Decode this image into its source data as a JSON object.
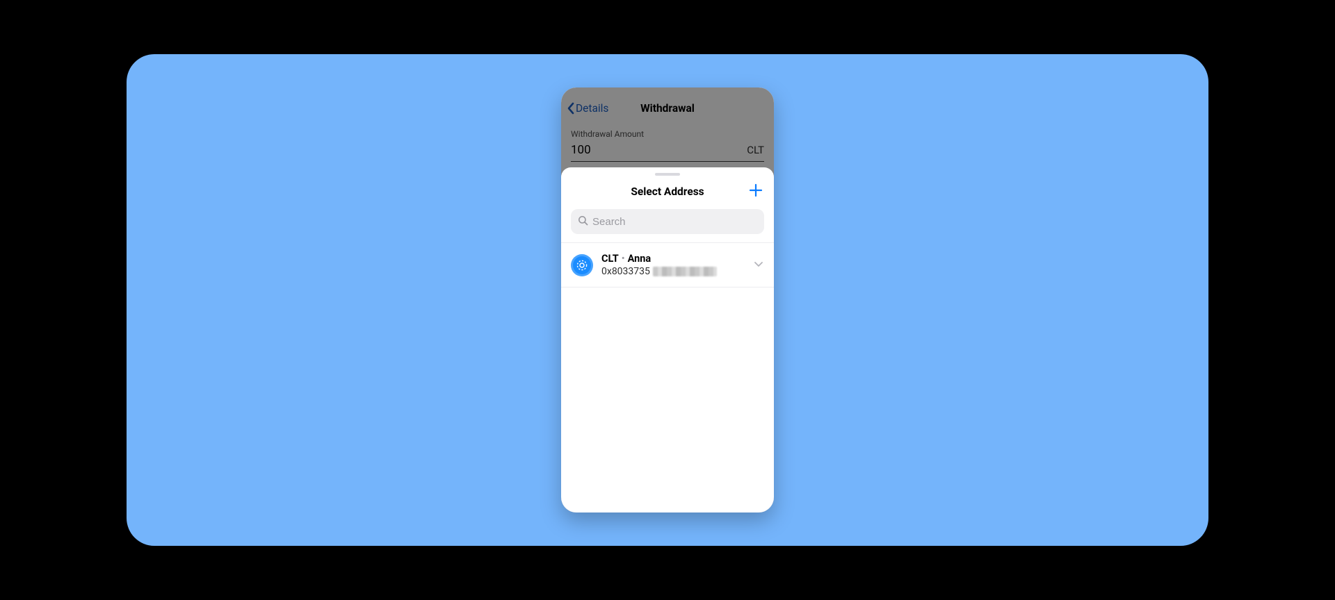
{
  "background_screen": {
    "back_label": "Details",
    "title": "Withdrawal",
    "amount_label": "Withdrawal Amount",
    "amount_value": "100",
    "amount_unit": "CLT"
  },
  "sheet": {
    "title": "Select Address",
    "search_placeholder": "Search",
    "addresses": [
      {
        "symbol": "CLT",
        "name": "Anna",
        "address_prefix": "0x8033735"
      }
    ]
  }
}
